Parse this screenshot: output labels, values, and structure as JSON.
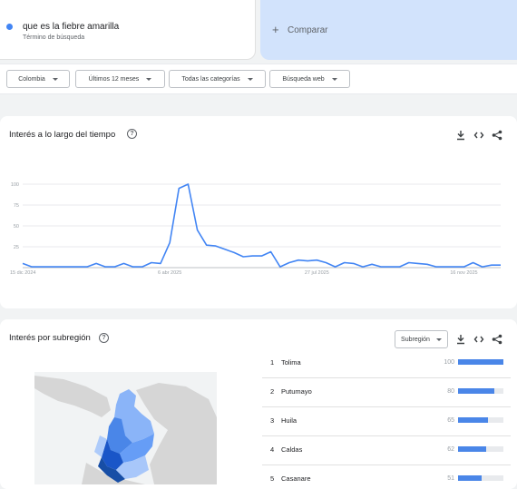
{
  "term": {
    "title": "que es la fiebre amarilla",
    "subtitle": "Término de búsqueda"
  },
  "compare": {
    "plus": "+",
    "label": "Comparar"
  },
  "filters": [
    {
      "label": "Colombia"
    },
    {
      "label": "Últimos 12 meses"
    },
    {
      "label": "Todas las categorías"
    },
    {
      "label": "Búsqueda web"
    }
  ],
  "time_card": {
    "title": "Interés a lo largo del tiempo",
    "help": "?"
  },
  "region_card": {
    "title": "Interés por subregión",
    "help": "?",
    "select_label": "Subregión"
  },
  "chart_data": {
    "type": "line",
    "y_ticks": [
      "100",
      "75",
      "50",
      "25"
    ],
    "ylim": [
      0,
      100
    ],
    "x_ticks": [
      {
        "label": "15 dic 2024",
        "index": 0
      },
      {
        "label": "6 abr 2025",
        "index": 16
      },
      {
        "label": "27 jul 2025",
        "index": 32
      },
      {
        "label": "16 nov 2025",
        "index": 48
      }
    ],
    "series": [
      {
        "color": "#4285f4",
        "values": [
          5,
          1,
          1,
          1,
          1,
          1,
          1,
          1,
          5,
          1,
          1,
          5,
          1,
          1,
          6,
          5,
          30,
          95,
          100,
          45,
          27,
          26,
          22,
          18,
          13,
          14,
          14,
          19,
          1,
          6,
          9,
          8,
          9,
          6,
          1,
          6,
          5,
          1,
          4,
          1,
          1,
          1,
          6,
          5,
          4,
          1,
          1,
          1,
          1,
          6,
          1,
          3,
          3
        ]
      }
    ]
  },
  "rankings": [
    {
      "rank": "1",
      "name": "Tolima",
      "value": "100",
      "pct": 100
    },
    {
      "rank": "2",
      "name": "Putumayo",
      "value": "80",
      "pct": 80
    },
    {
      "rank": "3",
      "name": "Huila",
      "value": "65",
      "pct": 65
    },
    {
      "rank": "4",
      "name": "Caldas",
      "value": "62",
      "pct": 62
    },
    {
      "rank": "5",
      "name": "Casanare",
      "value": "51",
      "pct": 51
    }
  ]
}
